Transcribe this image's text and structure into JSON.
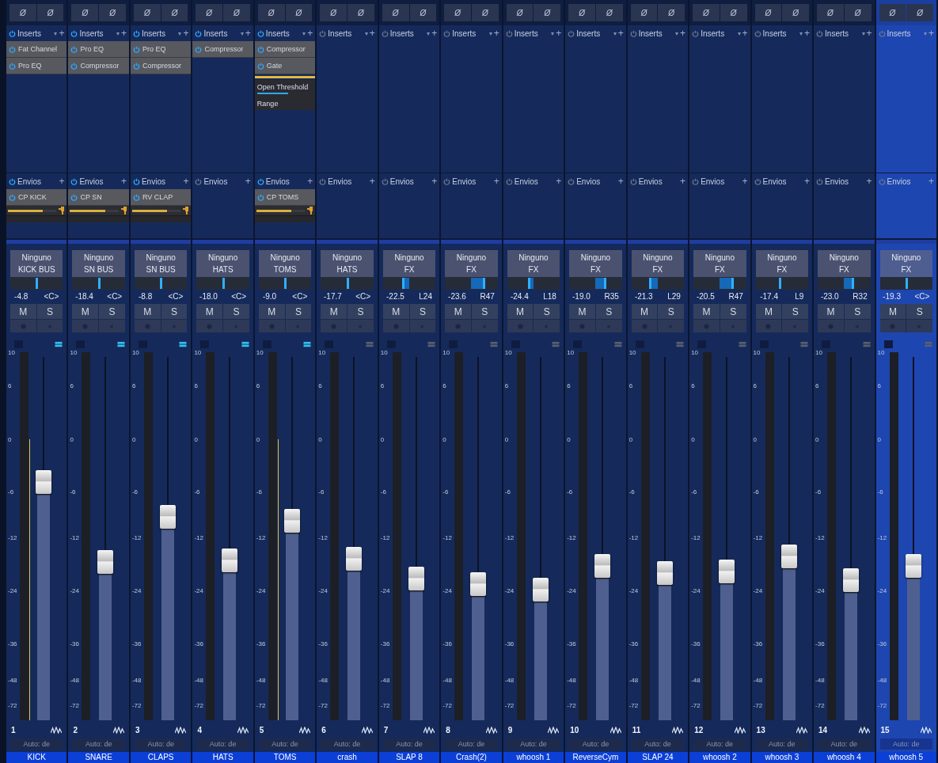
{
  "channels": [
    {
      "phase": [
        "Ø",
        "Ø"
      ],
      "inserts_header": {
        "label": "Inserts",
        "menu": "▾",
        "add": "+",
        "on": true
      },
      "inserts": [
        {
          "name": "Fat Channel",
          "on": true,
          "expanded": false
        },
        {
          "name": "Pro EQ",
          "on": true,
          "expanded": false
        }
      ],
      "sends_header": {
        "label": "Envios",
        "add": "+",
        "on": true
      },
      "sends": [
        {
          "name": "CP KICK",
          "on": true,
          "level": 0.72
        }
      ],
      "input": "Ninguno",
      "output": "KICK BUS",
      "pan": {
        "level": 0.5
      },
      "volume": "-4.8",
      "pan_reading": "<C>",
      "mute": "M",
      "solo": "S",
      "meter_button_on": true,
      "peak_hold": true,
      "scale": [
        "10",
        "6",
        "0",
        "-6",
        "-12",
        "-24",
        "-36",
        "-48",
        "-72"
      ],
      "fader": {
        "level": 0.655
      },
      "number": "1",
      "automation": "Auto: de",
      "name": "KICK",
      "selected": false
    },
    {
      "phase": [
        "Ø",
        "Ø"
      ],
      "inserts_header": {
        "label": "Inserts",
        "menu": "▾",
        "add": "+",
        "on": true
      },
      "inserts": [
        {
          "name": "Pro EQ",
          "on": true,
          "expanded": false
        },
        {
          "name": "Compressor",
          "on": true,
          "expanded": false
        }
      ],
      "sends_header": {
        "label": "Envios",
        "add": "+",
        "on": true
      },
      "sends": [
        {
          "name": "CP SN",
          "on": true,
          "level": 0.72
        }
      ],
      "input": "Ninguno",
      "output": "SN BUS",
      "pan": {
        "level": 0.5
      },
      "volume": "-18.4",
      "pan_reading": "<C>",
      "mute": "M",
      "solo": "S",
      "meter_button_on": true,
      "peak_hold": false,
      "scale": [
        "10",
        "6",
        "0",
        "-6",
        "-12",
        "-24",
        "-36",
        "-48",
        "-72"
      ],
      "fader": {
        "level": 0.435
      },
      "number": "2",
      "automation": "Auto: de",
      "name": "SNARE",
      "selected": false
    },
    {
      "phase": [
        "Ø",
        "Ø"
      ],
      "inserts_header": {
        "label": "Inserts",
        "menu": "▾",
        "add": "+",
        "on": true
      },
      "inserts": [
        {
          "name": "Pro EQ",
          "on": true,
          "expanded": false
        },
        {
          "name": "Compressor",
          "on": true,
          "expanded": false
        }
      ],
      "sends_header": {
        "label": "Envios",
        "add": "+",
        "on": true
      },
      "sends": [
        {
          "name": "RV CLAP",
          "on": true,
          "level": 0.72
        }
      ],
      "input": "Ninguno",
      "output": "SN BUS",
      "pan": {
        "level": 0.5
      },
      "volume": "-8.8",
      "pan_reading": "<C>",
      "mute": "M",
      "solo": "S",
      "meter_button_on": true,
      "peak_hold": false,
      "scale": [
        "10",
        "6",
        "0",
        "-6",
        "-12",
        "-24",
        "-36",
        "-48",
        "-72"
      ],
      "fader": {
        "level": 0.56
      },
      "number": "3",
      "automation": "Auto: de",
      "name": "CLAPS",
      "selected": false
    },
    {
      "phase": [
        "Ø",
        "Ø"
      ],
      "inserts_header": {
        "label": "Inserts",
        "menu": "▾",
        "add": "+",
        "on": true
      },
      "inserts": [
        {
          "name": "Compressor",
          "on": true,
          "expanded": false
        }
      ],
      "sends_header": {
        "label": "Envios",
        "add": "+",
        "on": false
      },
      "input": "Ninguno",
      "output": "HATS",
      "pan": {
        "level": 0.5
      },
      "volume": "-18.0",
      "pan_reading": "<C>",
      "mute": "M",
      "solo": "S",
      "meter_button_on": true,
      "peak_hold": false,
      "scale": [
        "10",
        "6",
        "0",
        "-6",
        "-12",
        "-24",
        "-36",
        "-48",
        "-72"
      ],
      "fader": {
        "level": 0.44
      },
      "number": "4",
      "automation": "Auto: de",
      "name": "HATS",
      "selected": false
    },
    {
      "phase": [
        "Ø",
        "Ø"
      ],
      "inserts_header": {
        "label": "Inserts",
        "menu": "▾",
        "add": "+",
        "on": true
      },
      "inserts": [
        {
          "name": "Compressor",
          "on": true,
          "expanded": false
        },
        {
          "name": "Gate",
          "on": true,
          "expanded": true,
          "params": [
            {
              "name": "Open Threshold",
              "level": 0.55
            },
            {
              "name": "Range"
            }
          ]
        }
      ],
      "sends_header": {
        "label": "Envios",
        "add": "+",
        "on": true
      },
      "sends": [
        {
          "name": "CP TOMS",
          "on": true,
          "level": 0.72
        }
      ],
      "input": "Ninguno",
      "output": "TOMS",
      "pan": {
        "level": 0.5
      },
      "volume": "-9.0",
      "pan_reading": "<C>",
      "mute": "M",
      "solo": "S",
      "meter_button_on": true,
      "peak_hold": true,
      "scale": [
        "10",
        "6",
        "0",
        "-6",
        "-12",
        "-24",
        "-36",
        "-48",
        "-72"
      ],
      "fader": {
        "level": 0.55
      },
      "number": "5",
      "automation": "Auto: de",
      "name": "TOMS",
      "selected": false
    },
    {
      "phase": [
        "Ø",
        "Ø"
      ],
      "inserts_header": {
        "label": "Inserts",
        "menu": "▾",
        "add": "+",
        "on": false
      },
      "sends_header": {
        "label": "Envios",
        "add": "+",
        "on": false
      },
      "input": "Ninguno",
      "output": "HATS",
      "pan": {
        "level": 0.5
      },
      "volume": "-17.7",
      "pan_reading": "<C>",
      "mute": "M",
      "solo": "S",
      "meter_button_on": false,
      "peak_hold": false,
      "scale": [
        "10",
        "6",
        "0",
        "-6",
        "-12",
        "-24",
        "-36",
        "-48",
        "-72"
      ],
      "fader": {
        "level": 0.445
      },
      "number": "6",
      "automation": "Auto: de",
      "name": "crash",
      "selected": false
    },
    {
      "phase": [
        "Ø",
        "Ø"
      ],
      "inserts_header": {
        "label": "Inserts",
        "menu": "▾",
        "add": "+",
        "on": false
      },
      "sends_header": {
        "label": "Envios",
        "add": "+",
        "on": false
      },
      "input": "Ninguno",
      "output": "FX",
      "pan": {
        "level": 0.38
      },
      "volume": "-22.5",
      "pan_reading": "L24",
      "mute": "M",
      "solo": "S",
      "meter_button_on": false,
      "peak_hold": false,
      "scale": [
        "10",
        "6",
        "0",
        "-6",
        "-12",
        "-24",
        "-36",
        "-48",
        "-72"
      ],
      "fader": {
        "level": 0.39
      },
      "number": "7",
      "automation": "Auto: de",
      "name": "SLAP 8",
      "selected": false
    },
    {
      "phase": [
        "Ø",
        "Ø"
      ],
      "inserts_header": {
        "label": "Inserts",
        "menu": "▾",
        "add": "+",
        "on": false
      },
      "sends_header": {
        "label": "Envios",
        "add": "+",
        "on": false
      },
      "input": "Ninguno",
      "output": "FX",
      "pan": {
        "level": 0.735
      },
      "volume": "-23.6",
      "pan_reading": "R47",
      "mute": "M",
      "solo": "S",
      "meter_button_on": false,
      "peak_hold": false,
      "scale": [
        "10",
        "6",
        "0",
        "-6",
        "-12",
        "-24",
        "-36",
        "-48",
        "-72"
      ],
      "fader": {
        "level": 0.375
      },
      "number": "8",
      "automation": "Auto: de",
      "name": "Crash(2)",
      "selected": false
    },
    {
      "phase": [
        "Ø",
        "Ø"
      ],
      "inserts_header": {
        "label": "Inserts",
        "menu": "▾",
        "add": "+",
        "on": false
      },
      "sends_header": {
        "label": "Envios",
        "add": "+",
        "on": false
      },
      "input": "Ninguno",
      "output": "FX",
      "pan": {
        "level": 0.41
      },
      "volume": "-24.4",
      "pan_reading": "L18",
      "mute": "M",
      "solo": "S",
      "meter_button_on": false,
      "peak_hold": false,
      "scale": [
        "10",
        "6",
        "0",
        "-6",
        "-12",
        "-24",
        "-36",
        "-48",
        "-72"
      ],
      "fader": {
        "level": 0.36
      },
      "number": "9",
      "automation": "Auto: de",
      "name": "whoosh 1",
      "selected": false
    },
    {
      "phase": [
        "Ø",
        "Ø"
      ],
      "inserts_header": {
        "label": "Inserts",
        "menu": "▾",
        "add": "+",
        "on": false
      },
      "sends_header": {
        "label": "Envios",
        "add": "+",
        "on": false
      },
      "input": "Ninguno",
      "output": "FX",
      "pan": {
        "level": 0.675
      },
      "volume": "-19.0",
      "pan_reading": "R35",
      "mute": "M",
      "solo": "S",
      "meter_button_on": false,
      "peak_hold": false,
      "scale": [
        "10",
        "6",
        "0",
        "-6",
        "-12",
        "-24",
        "-36",
        "-48",
        "-72"
      ],
      "fader": {
        "level": 0.425
      },
      "number": "10",
      "automation": "Auto: de",
      "name": "ReverseCym",
      "selected": false
    },
    {
      "phase": [
        "Ø",
        "Ø"
      ],
      "inserts_header": {
        "label": "Inserts",
        "menu": "▾",
        "add": "+",
        "on": false
      },
      "sends_header": {
        "label": "Envios",
        "add": "+",
        "on": false
      },
      "input": "Ninguno",
      "output": "FX",
      "pan": {
        "level": 0.355
      },
      "volume": "-21.3",
      "pan_reading": "L29",
      "mute": "M",
      "solo": "S",
      "meter_button_on": false,
      "peak_hold": false,
      "scale": [
        "10",
        "6",
        "0",
        "-6",
        "-12",
        "-24",
        "-36",
        "-48",
        "-72"
      ],
      "fader": {
        "level": 0.405
      },
      "number": "11",
      "automation": "Auto: de",
      "name": "SLAP 24",
      "selected": false
    },
    {
      "phase": [
        "Ø",
        "Ø"
      ],
      "inserts_header": {
        "label": "Inserts",
        "menu": "▾",
        "add": "+",
        "on": false
      },
      "sends_header": {
        "label": "Envios",
        "add": "+",
        "on": false
      },
      "input": "Ninguno",
      "output": "FX",
      "pan": {
        "level": 0.735
      },
      "volume": "-20.5",
      "pan_reading": "R47",
      "mute": "M",
      "solo": "S",
      "meter_button_on": false,
      "peak_hold": false,
      "scale": [
        "10",
        "6",
        "0",
        "-6",
        "-12",
        "-24",
        "-36",
        "-48",
        "-72"
      ],
      "fader": {
        "level": 0.41
      },
      "number": "12",
      "automation": "Auto: de",
      "name": "whoosh 2",
      "selected": false
    },
    {
      "phase": [
        "Ø",
        "Ø"
      ],
      "inserts_header": {
        "label": "Inserts",
        "menu": "▾",
        "add": "+",
        "on": false
      },
      "sends_header": {
        "label": "Envios",
        "add": "+",
        "on": false
      },
      "input": "Ninguno",
      "output": "FX",
      "pan": {
        "level": 0.455
      },
      "volume": "-17.4",
      "pan_reading": "L9",
      "mute": "M",
      "solo": "S",
      "meter_button_on": false,
      "peak_hold": false,
      "scale": [
        "10",
        "6",
        "0",
        "-6",
        "-12",
        "-24",
        "-36",
        "-48",
        "-72"
      ],
      "fader": {
        "level": 0.45
      },
      "number": "13",
      "automation": "Auto: de",
      "name": "whoosh 3",
      "selected": false
    },
    {
      "phase": [
        "Ø",
        "Ø"
      ],
      "inserts_header": {
        "label": "Inserts",
        "menu": "▾",
        "add": "+",
        "on": false
      },
      "sends_header": {
        "label": "Envios",
        "add": "+",
        "on": false
      },
      "input": "Ninguno",
      "output": "FX",
      "pan": {
        "level": 0.66
      },
      "volume": "-23.0",
      "pan_reading": "R32",
      "mute": "M",
      "solo": "S",
      "meter_button_on": false,
      "peak_hold": false,
      "scale": [
        "10",
        "6",
        "0",
        "-6",
        "-12",
        "-24",
        "-36",
        "-48",
        "-72"
      ],
      "fader": {
        "level": 0.385
      },
      "number": "14",
      "automation": "Auto: de",
      "name": "whoosh 4",
      "selected": false
    },
    {
      "phase": [
        "Ø",
        "Ø"
      ],
      "inserts_header": {
        "label": "Inserts",
        "menu": "▾",
        "add": "+",
        "on": false
      },
      "sends_header": {
        "label": "Envios",
        "add": "+",
        "on": false
      },
      "input": "Ninguno",
      "output": "FX",
      "pan": {
        "level": 0.5
      },
      "volume": "-19.3",
      "pan_reading": "<C>",
      "mute": "M",
      "solo": "S",
      "meter_button_on": false,
      "peak_hold": false,
      "scale": [
        "10",
        "6",
        "0",
        "-6",
        "-12",
        "-24",
        "-36",
        "-48",
        "-72"
      ],
      "fader": {
        "level": 0.425
      },
      "number": "15",
      "automation": "Auto: de",
      "name": "whoosh 5",
      "selected": true
    }
  ]
}
